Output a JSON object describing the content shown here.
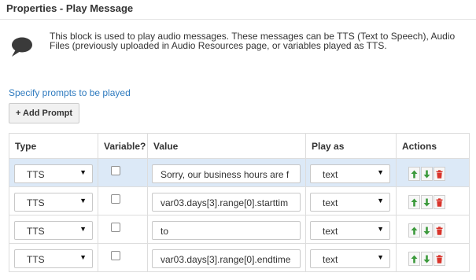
{
  "panel": {
    "title": "Properties - Play Message",
    "description": "This block is used to play audio messages. These messages can be TTS (Text to Speech), Audio Files (previously uploaded in Audio Resources page, or variables played as TTS."
  },
  "prompts": {
    "section_label": "Specify prompts to be played",
    "add_button": "+ Add Prompt",
    "columns": {
      "type": "Type",
      "variable": "Variable?",
      "value": "Value",
      "play_as": "Play as",
      "actions": "Actions"
    },
    "rows": [
      {
        "type": "TTS",
        "variable": false,
        "value": "Sorry, our business hours are f",
        "play_as": "text",
        "selected": true
      },
      {
        "type": "TTS",
        "variable": false,
        "value": "var03.days[3].range[0].starttim",
        "play_as": "text",
        "selected": false
      },
      {
        "type": "TTS",
        "variable": false,
        "value": "to",
        "play_as": "text",
        "selected": false
      },
      {
        "type": "TTS",
        "variable": false,
        "value": "var03.days[3].range[0].endtime",
        "play_as": "text",
        "selected": false
      }
    ]
  },
  "icons": {
    "info": "speech-bubble-icon",
    "move_up": "arrow-up-icon",
    "move_down": "arrow-down-icon",
    "delete": "trash-icon"
  },
  "colors": {
    "link": "#2f7bbf",
    "selected_row": "#dce9f7",
    "arrow_green": "#3c9a3c",
    "delete_red": "#d9342b"
  }
}
